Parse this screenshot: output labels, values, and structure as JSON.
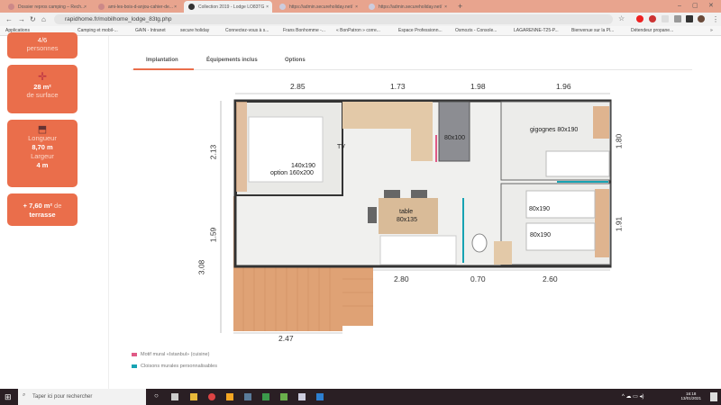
{
  "browser": {
    "tabs": [
      {
        "title": "Dossier repros camping – Rech..."
      },
      {
        "title": "ami-les-bois-d-anjou-cahier-de..."
      },
      {
        "title": "Collection 2019 - Lodge LO83TG"
      },
      {
        "title": "https://admin.secureholiday.net/"
      },
      {
        "title": "https://admin.secureholiday.net/"
      }
    ],
    "new_tab": "+",
    "url": "rapidhome.fr/mobilhome_lodge_83tg.php",
    "bookmarks": [
      "Applications",
      "Camping et mobil-...",
      "GAIN - Intranet",
      "secure holiday",
      "Connectez-vous à s...",
      "Frans Bonhomme -...",
      "« BonPatron » corre...",
      "Espace Professionn...",
      "Osmozis - Console...",
      "LAGARENNE-T25-P...",
      "Bienvenue sur la Pl...",
      "Détendeur propane..."
    ]
  },
  "sidebar": {
    "capacity_label": "personnes",
    "capacity_value": "4/6",
    "surface_value": "28 m²",
    "surface_label": "de surface",
    "length_label": "Longueur",
    "length_value": "8,70 m",
    "width_label": "Largeur",
    "width_value": "4 m",
    "terrace_value": "+ 7,60 m²",
    "terrace_de": "de",
    "terrace_label": "terrasse"
  },
  "page_tabs": [
    "Implantation",
    "Équipements inclus",
    "Options"
  ],
  "plan": {
    "dims_top": [
      "2.85",
      "1.73",
      "1.98",
      "1.96"
    ],
    "dims_left": [
      "2.13",
      "1.59",
      "3.08"
    ],
    "dims_right": [
      "1.80",
      "1.91"
    ],
    "dims_bottom": [
      "2.80",
      "0.70",
      "2.60"
    ],
    "dim_terrace": "2.47",
    "rooms": {
      "master_bed": "140x190",
      "master_bed_option": "option 160x200",
      "tv": "TV",
      "bunk": "80x100",
      "gigognes": "gigognes 80x190",
      "bed2": "80x190",
      "bed3": "80x190",
      "table": "table",
      "table_size": "80x135"
    }
  },
  "legend": [
    {
      "label": "Motif mural «Istanbul» (cuisine)",
      "color": "#e05a86"
    },
    {
      "label": "Cloisons murales personnalisables",
      "color": "#17a3b3"
    }
  ],
  "taskbar": {
    "search_placeholder": "Taper ici pour rechercher",
    "time": "16:18",
    "date": "13/01/2021"
  },
  "colors": {
    "accent": "#ea6e4b",
    "wood": "#dfa275"
  }
}
